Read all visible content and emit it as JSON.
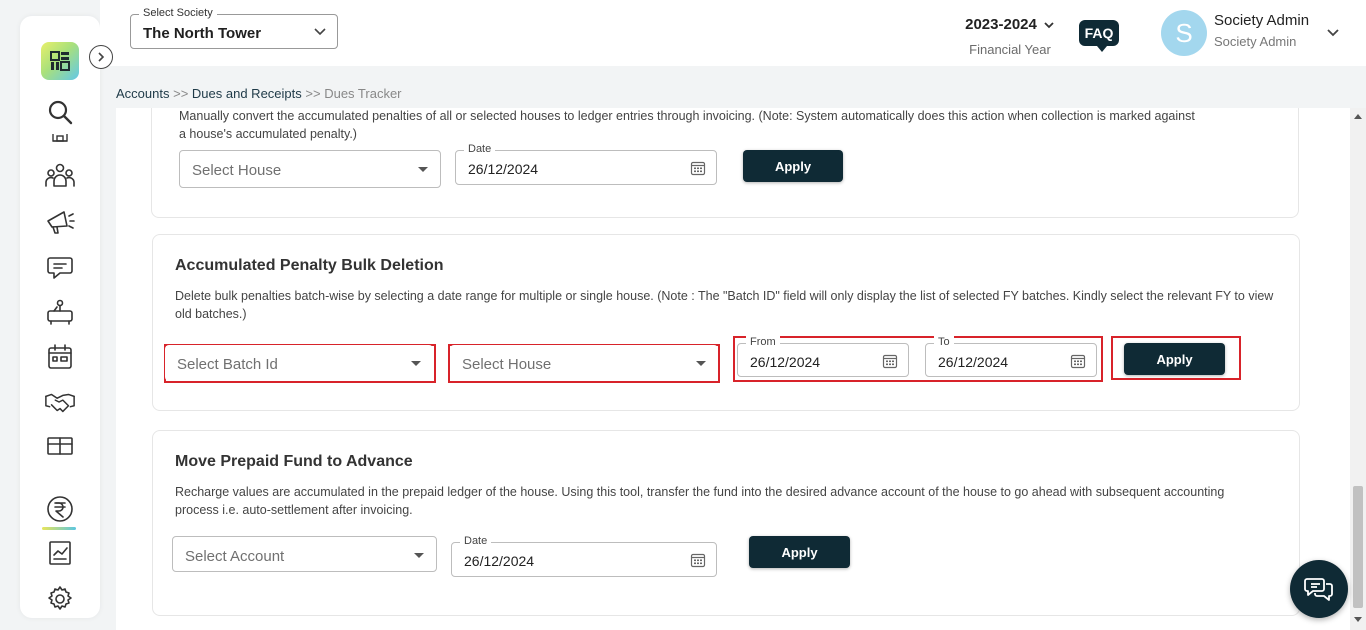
{
  "header": {
    "society_legend": "Select Society",
    "society_value": "The North Tower",
    "fy_value": "2023-2024",
    "fy_label": "Financial Year",
    "faq_label": "FAQ",
    "avatar_letter": "S",
    "user_name": "Society Admin",
    "user_role": "Society Admin"
  },
  "sidebar": {
    "items": [
      "search-icon",
      "community-icon",
      "announcement-icon",
      "chat-icon",
      "amenity-icon",
      "calendar-icon",
      "handshake-icon",
      "package-icon",
      "rupee-icon",
      "report-icon",
      "gear-icon"
    ],
    "active": "rupee-icon"
  },
  "breadcrumb": {
    "accounts": "Accounts",
    "sep1": ">>",
    "dues": "Dues and Receipts",
    "sep2": ">>",
    "current": "Dues Tracker"
  },
  "section1": {
    "desc_line1": "Manually convert the accumulated penalties of all or selected houses to ledger entries through invoicing. (Note: System automatically does this action when collection is marked against",
    "desc_line2": "a house's accumulated penalty.)",
    "house_placeholder": "Select House",
    "date_legend": "Date",
    "date_value": "26/12/2024",
    "apply_label": "Apply"
  },
  "section2": {
    "title": "Accumulated Penalty Bulk Deletion",
    "desc_line1": "Delete bulk penalties batch-wise by selecting a date range for multiple or single house. (Note : The \"Batch ID\" field will only display the list of selected FY batches. Kindly select the relevant FY to view",
    "desc_line2": "old batches.)",
    "batch_placeholder": "Select Batch Id",
    "house_placeholder": "Select House",
    "from_legend": "From",
    "from_value": "26/12/2024",
    "to_legend": "To",
    "to_value": "26/12/2024",
    "apply_label": "Apply"
  },
  "section3": {
    "title": "Move Prepaid Fund to Advance",
    "desc_line1": "Recharge values are accumulated in the prepaid ledger of the house. Using this tool, transfer the fund into the desired advance account of the house to go ahead with subsequent accounting",
    "desc_line2": "process i.e. auto-settlement after invoicing.",
    "account_placeholder": "Select Account",
    "date_legend": "Date",
    "date_value": "26/12/2024",
    "apply_label": "Apply"
  },
  "colors": {
    "primary": "#0f2a35",
    "highlight": "#d8232a",
    "avatar": "#a3d7ee"
  }
}
